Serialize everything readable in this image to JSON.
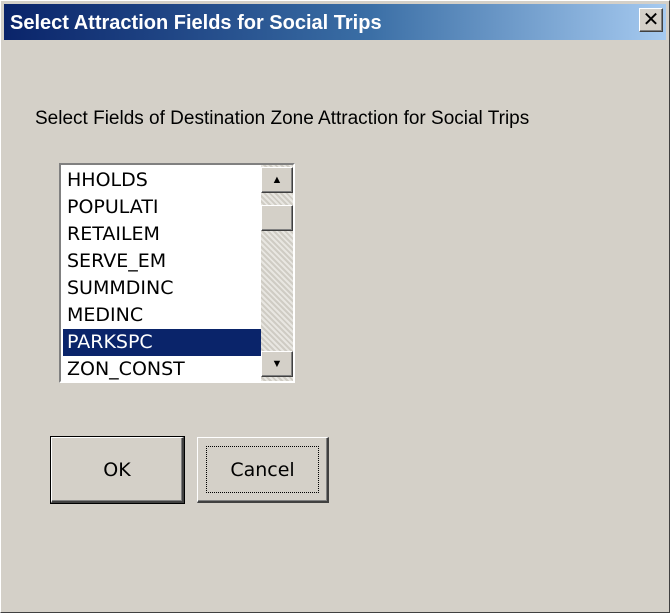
{
  "window": {
    "title": "Select Attraction Fields for Social Trips",
    "close_glyph": "✕",
    "close_icon": "close-icon"
  },
  "prompt": "Select Fields of Destination Zone Attraction for Social Trips",
  "fields_list": {
    "items": [
      "HHOLDS",
      "POPULATI",
      "RETAILEM",
      "SERVE_EM",
      "SUMMDINC",
      "MEDINC",
      "PARKSPC",
      "ZON_CONST"
    ],
    "selected": "PARKSPC",
    "scroll_up_glyph": "▲",
    "scroll_down_glyph": "▼"
  },
  "buttons": {
    "ok_label": "OK",
    "cancel_label": "Cancel"
  },
  "colors": {
    "title_bar_start": "#0a246a",
    "title_bar_end": "#a6caf0",
    "selection": "#0a246a",
    "face": "#d4d0c8"
  }
}
